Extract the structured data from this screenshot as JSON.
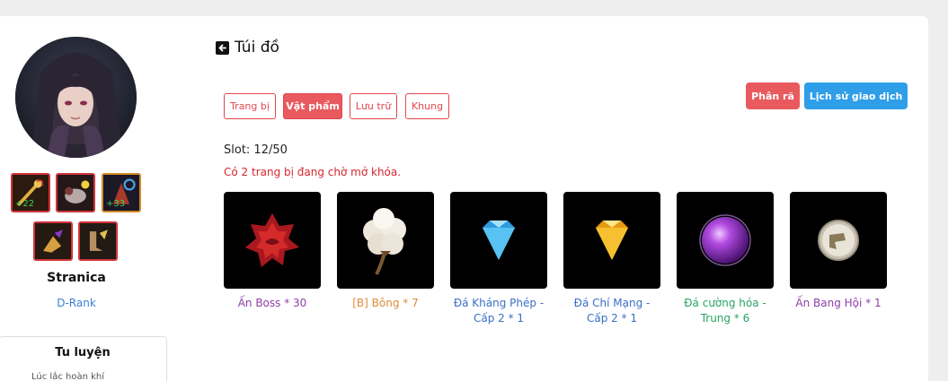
{
  "profile": {
    "avatar_icon": "hooded-character-avatar",
    "equipment": [
      {
        "icon": "golden-staff-icon",
        "level": "+22",
        "border": "#d0343a"
      },
      {
        "icon": "beast-mount-icon",
        "level": "",
        "border": "#d0343a"
      },
      {
        "icon": "swirl-armor-icon",
        "level": "+33",
        "border": "#d08a2a"
      },
      {
        "icon": "purple-gauntlet-icon",
        "level": "",
        "border": "#d0343a"
      },
      {
        "icon": "winged-boots-icon",
        "level": "",
        "border": "#d0343a"
      }
    ],
    "name": "Stranica",
    "rank": "D-Rank"
  },
  "panel": {
    "title": "Tu luyện",
    "subtitle": "Lúc lắc hoàn khí"
  },
  "header": {
    "back_icon": "arrow-left-square-icon",
    "title": "Túi đồ"
  },
  "tabs": [
    {
      "label": "Trang bị",
      "active": false
    },
    {
      "label": "Vật phẩm",
      "active": true
    },
    {
      "label": "Lưu trữ",
      "active": false
    },
    {
      "label": "Khung",
      "active": false
    }
  ],
  "actions": {
    "disassemble": "Phân rã",
    "history": "Lịch sử giao dịch"
  },
  "inventory": {
    "slot_text": "Slot: 12/50",
    "notice": "Có 2 trang bị đang chờ mở khóa.",
    "items": [
      {
        "name": "Ấn Boss * 30",
        "color": "#8e3ea8",
        "icon": "red-boss-seal-icon"
      },
      {
        "name": "[B] Bông * 7",
        "color": "#e08a3a",
        "icon": "cotton-flower-icon"
      },
      {
        "name": "Đá Kháng Phép - Cấp 2 * 1",
        "color": "#3a6fc4",
        "icon": "blue-diamond-icon"
      },
      {
        "name": "Đá Chí Mạng - Cấp 2 * 1",
        "color": "#3a6fc4",
        "icon": "yellow-diamond-icon"
      },
      {
        "name": "Đá cường hóa - Trung * 6",
        "color": "#28a463",
        "icon": "purple-orb-icon"
      },
      {
        "name": "Ấn Bang Hội * 1",
        "color": "#8e3ea8",
        "icon": "guild-seal-coin-icon"
      }
    ]
  },
  "colors": {
    "accent_red": "#e85a5e",
    "accent_blue": "#2f9ee8",
    "notice_red": "#d6262f",
    "rank_blue": "#3b7fd1"
  }
}
